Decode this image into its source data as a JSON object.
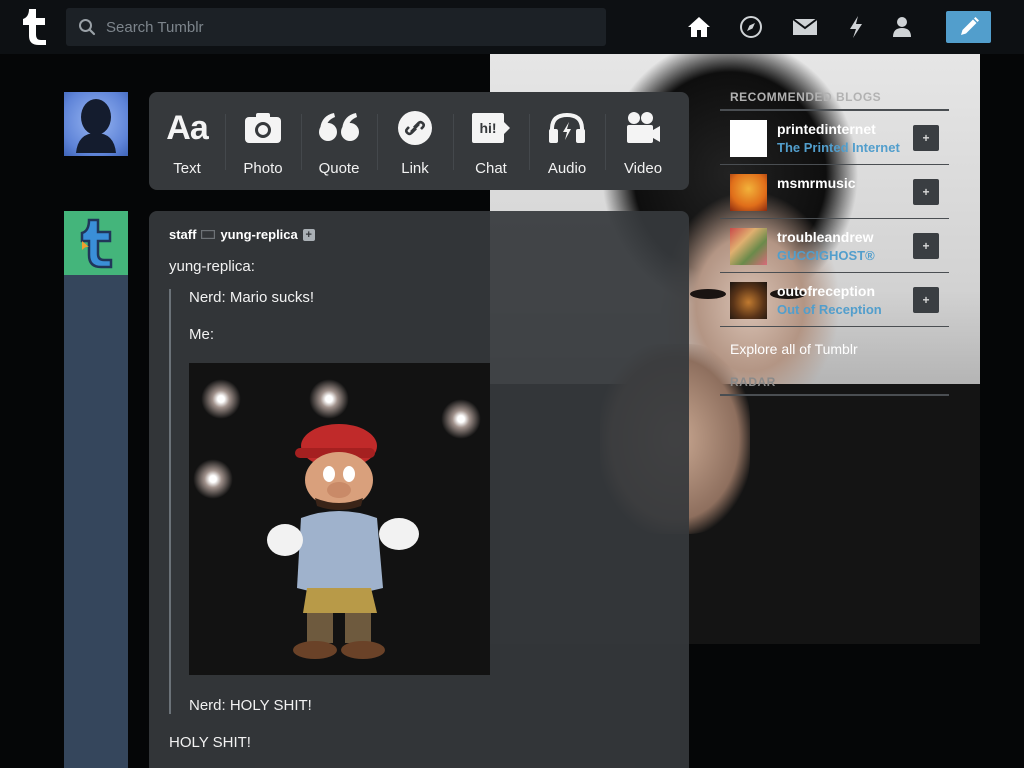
{
  "topbar": {
    "search_placeholder": "Search Tumblr",
    "icons": [
      "home-icon",
      "explore-icon",
      "mail-icon",
      "activity-icon",
      "account-icon"
    ],
    "compose_icon": "pencil-icon",
    "accent": "#529ecc"
  },
  "post_types": [
    {
      "label": "Text",
      "icon": "text-icon"
    },
    {
      "label": "Photo",
      "icon": "camera-icon"
    },
    {
      "label": "Quote",
      "icon": "quote-icon"
    },
    {
      "label": "Link",
      "icon": "link-icon"
    },
    {
      "label": "Chat",
      "icon": "chat-icon",
      "glyph": "hi!"
    },
    {
      "label": "Audio",
      "icon": "headphones-icon"
    },
    {
      "label": "Video",
      "icon": "video-camera-icon"
    }
  ],
  "post": {
    "author": "staff",
    "reblogged_from": "yung-replica",
    "source_label": "yung-replica:",
    "quote_lines": {
      "line1": "Nerd: Mario sucks!",
      "line2": "Me:",
      "line3": "Nerd: HOLY SHIT!"
    },
    "reply": "HOLY SHIT!"
  },
  "sidebar": {
    "recommended_title": "RECOMMENDED BLOGS",
    "blogs": [
      {
        "name": "printedinternet",
        "title": "The Printed Internet",
        "follow": "+"
      },
      {
        "name": "msmrmusic",
        "title": "",
        "follow": "+"
      },
      {
        "name": "troubleandrew",
        "title": "GUCCIGHOST®",
        "follow": "+"
      },
      {
        "name": "outofreception",
        "title": "Out of Reception",
        "follow": "+"
      }
    ],
    "explore": "Explore all of Tumblr",
    "radar_title": "RADAR"
  }
}
